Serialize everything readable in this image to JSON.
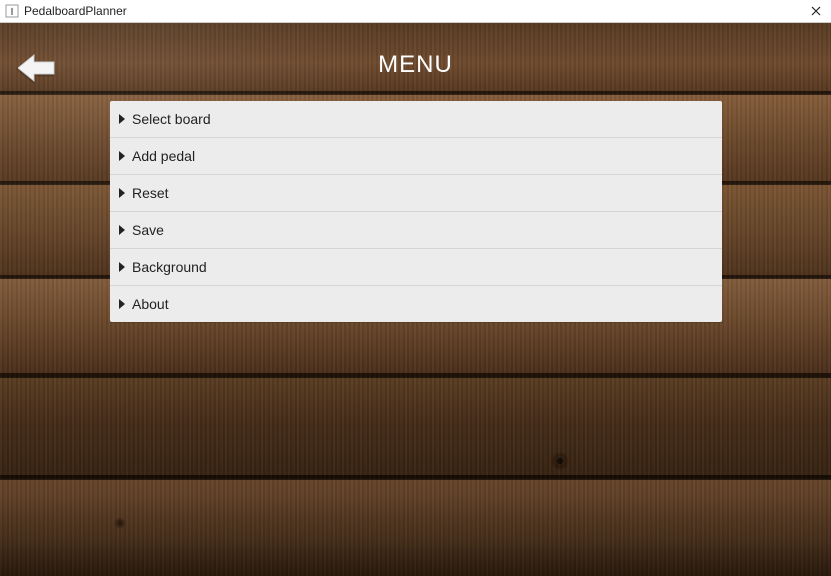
{
  "window": {
    "title": "PedalboardPlanner"
  },
  "header": {
    "menu_title": "MENU"
  },
  "menu": {
    "items": [
      {
        "label": "Select board"
      },
      {
        "label": "Add pedal"
      },
      {
        "label": "Reset"
      },
      {
        "label": "Save"
      },
      {
        "label": "Background"
      },
      {
        "label": "About"
      }
    ]
  }
}
